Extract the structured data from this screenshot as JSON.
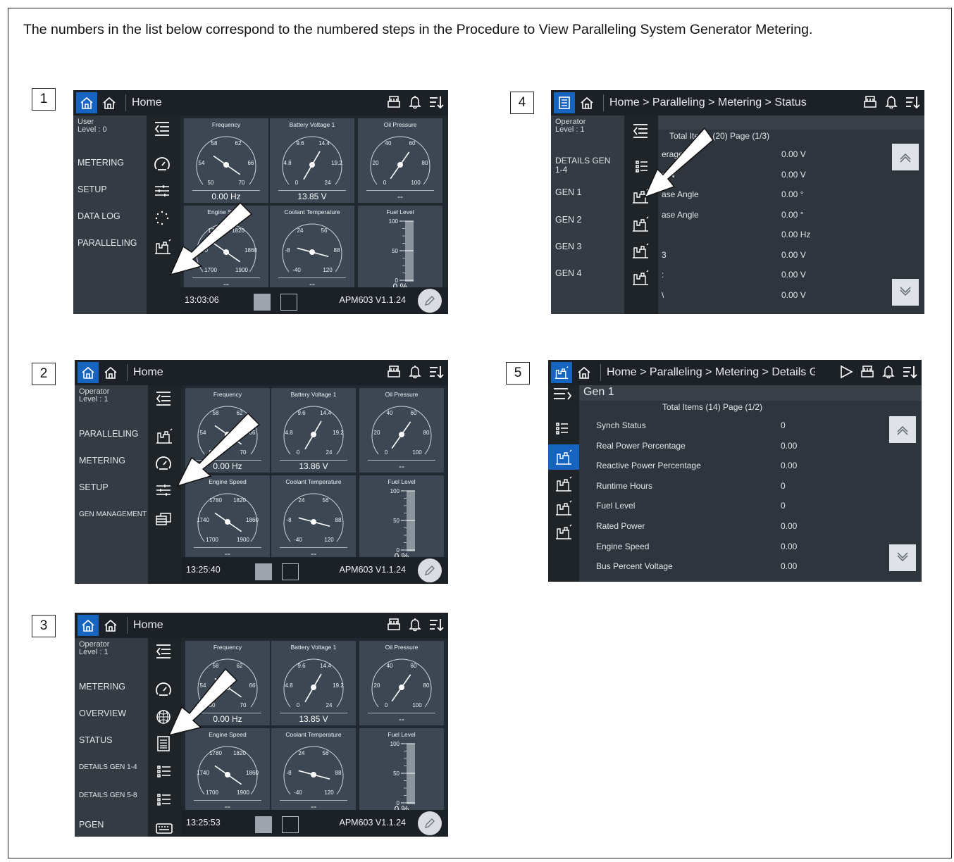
{
  "intro_text": "The numbers in the list below correspond to the numbered steps in the Procedure to View Paralleling System Generator Metering.",
  "common": {
    "home": "Home",
    "version": "APM603 V1.1.24",
    "gauges": {
      "frequency": {
        "title": "Frequency",
        "ticks": [
          "58",
          "62",
          "54",
          "66",
          "50",
          "70"
        ]
      },
      "battery": {
        "title": "Battery Voltage 1",
        "ticks": [
          "9.6",
          "14.4",
          "4.8",
          "19.2",
          "0",
          "24"
        ]
      },
      "oil": {
        "title": "Oil Pressure",
        "ticks": [
          "40",
          "60",
          "20",
          "80",
          "0",
          "100"
        ],
        "value": "--"
      },
      "engine": {
        "title": "Engine Speed",
        "ticks": [
          "1780",
          "1820",
          "1740",
          "1860",
          "1700",
          "1900"
        ],
        "value": "--"
      },
      "coolant": {
        "title": "Coolant Temperature",
        "ticks": [
          "24",
          "56",
          "-8",
          "88",
          "-40",
          "120"
        ],
        "value": "--"
      },
      "fuel": {
        "title": "Fuel Level",
        "ticks": [
          "100",
          "50",
          "0"
        ],
        "value": "0 %"
      }
    }
  },
  "steps": [
    {
      "number": "1",
      "user": "User",
      "level": "Level : 0",
      "menu": [
        "METERING",
        "SETUP",
        "DATA LOG",
        "PARALLELING"
      ],
      "frequency_value": "0.00 Hz",
      "battery_value": "13.85 V",
      "time": "13:03:06"
    },
    {
      "number": "2",
      "user": "Operator",
      "level": "Level : 1",
      "menu": [
        "PARALLELING",
        "METERING",
        "SETUP",
        "GEN MANAGEMENT"
      ],
      "frequency_value": "0.00 Hz",
      "battery_value": "13.86 V",
      "time": "13:25:40"
    },
    {
      "number": "3",
      "user": "Operator",
      "level": "Level : 1",
      "menu": [
        "METERING",
        "OVERVIEW",
        "STATUS",
        "DETAILS GEN 1-4",
        "DETAILS GEN 5-8",
        "PGEN"
      ],
      "frequency_value": "0.00 Hz",
      "battery_value": "13.85 V",
      "time": "13:25:53"
    },
    {
      "number": "4",
      "user": "Operator",
      "level": "Level : 1",
      "breadcrumb": "Home > Paralleling > Metering > Status",
      "menu": [
        "DETAILS GEN 1-4",
        "GEN 1",
        "GEN 2",
        "GEN 3",
        "GEN 4"
      ],
      "total_items": "Total Items (20) Page (1/3)",
      "rows": [
        {
          "label": "erage",
          "value": "0.00 V"
        },
        {
          "label": "o N",
          "value": "0.00 V"
        },
        {
          "label": "ase Angle",
          "value": "0.00 °"
        },
        {
          "label": "ase Angle",
          "value": "0.00 °"
        },
        {
          "label": "",
          "value": "0.00 Hz"
        },
        {
          "label": "3",
          "value": "0.00 V"
        },
        {
          "label": ":",
          "value": "0.00 V"
        },
        {
          "label": "\\",
          "value": "0.00 V"
        }
      ]
    },
    {
      "number": "5",
      "breadcrumb": "Home > Paralleling > Metering > Details Gen",
      "title": "Gen 1",
      "total_items": "Total Items (14) Page (1/2)",
      "rows": [
        {
          "label": "Synch Status",
          "value": "0"
        },
        {
          "label": "Real Power Percentage",
          "value": "0.00"
        },
        {
          "label": "Reactive Power Percentage",
          "value": "0.00"
        },
        {
          "label": "Runtime Hours",
          "value": "0"
        },
        {
          "label": "Fuel Level",
          "value": "0"
        },
        {
          "label": "Rated Power",
          "value": "0.00"
        },
        {
          "label": "Engine Speed",
          "value": "0.00"
        },
        {
          "label": "Bus Percent Voltage",
          "value": "0.00"
        }
      ]
    }
  ]
}
